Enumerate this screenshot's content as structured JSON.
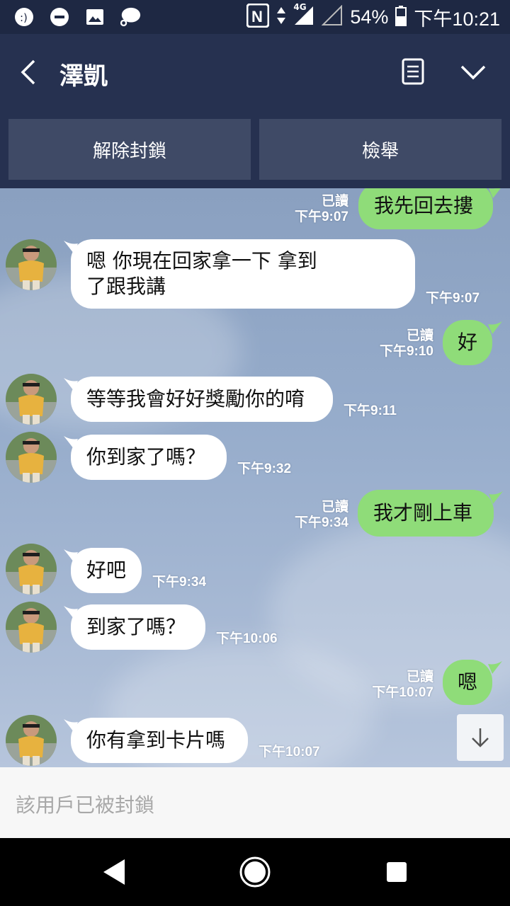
{
  "status_bar": {
    "battery": "54%",
    "time": "下午10:21",
    "network": "4G"
  },
  "header": {
    "contact_name": "澤凱"
  },
  "actions": {
    "unblock": "解除封鎖",
    "report": "檢舉"
  },
  "messages": [
    {
      "side": "out",
      "text": "我先回去摟",
      "read": "已讀",
      "time": "下午9:07"
    },
    {
      "side": "in",
      "line1": "嗯 你現在回家拿一下 拿到",
      "line2": "了跟我講",
      "time": "下午9:07"
    },
    {
      "side": "out",
      "text": "好",
      "read": "已讀",
      "time": "下午9:10"
    },
    {
      "side": "in",
      "text": "等等我會好好獎勵你的唷",
      "time": "下午9:11"
    },
    {
      "side": "in",
      "text": "你到家了嗎？",
      "time": "下午9:32"
    },
    {
      "side": "out",
      "text": "我才剛上車",
      "read": "已讀",
      "time": "下午9:34"
    },
    {
      "side": "in",
      "text": "好吧",
      "time": "下午9:34"
    },
    {
      "side": "in",
      "text": "到家了嗎？",
      "time": "下午10:06"
    },
    {
      "side": "out",
      "text": "嗯",
      "read": "已讀",
      "time": "下午10:07"
    },
    {
      "side": "in",
      "text": "你有拿到卡片嗎",
      "time": "下午10:07"
    }
  ],
  "input": {
    "blocked_notice": "該用戶已被封鎖"
  },
  "colors": {
    "header_bg": "#263150",
    "outgoing_bubble": "#8fdc79",
    "incoming_bubble": "#ffffff"
  }
}
